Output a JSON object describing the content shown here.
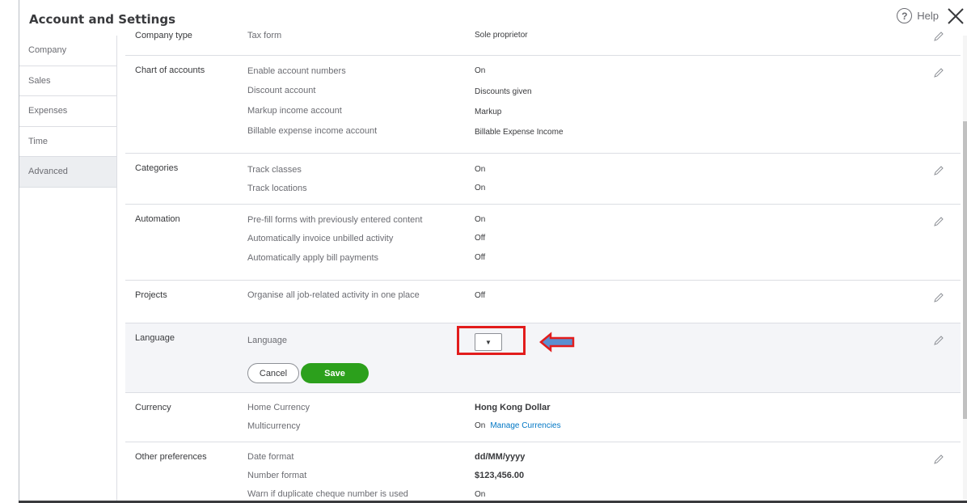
{
  "header": {
    "title": "Account and Settings",
    "help_label": "Help"
  },
  "sidebar": {
    "items": [
      "Company",
      "Sales",
      "Expenses",
      "Time",
      "Advanced"
    ]
  },
  "partial_row": {
    "title": "Company type",
    "label": "Tax form",
    "value": "Sole proprietor"
  },
  "chart_of_accounts": {
    "title": "Chart of accounts",
    "rows": [
      {
        "label": "Enable account numbers",
        "value": "On"
      },
      {
        "label": "Discount account",
        "value": "Discounts given"
      },
      {
        "label": "Markup income account",
        "value": "Markup"
      },
      {
        "label": "Billable expense income account",
        "value": "Billable Expense Income"
      }
    ]
  },
  "categories": {
    "title": "Categories",
    "rows": [
      {
        "label": "Track classes",
        "value": "On"
      },
      {
        "label": "Track locations",
        "value": "On"
      }
    ]
  },
  "automation": {
    "title": "Automation",
    "rows": [
      {
        "label": "Pre-fill forms with previously entered content",
        "value": "On"
      },
      {
        "label": "Automatically invoice unbilled activity",
        "value": "Off"
      },
      {
        "label": "Automatically apply bill payments",
        "value": "Off"
      }
    ]
  },
  "projects": {
    "title": "Projects",
    "rows": [
      {
        "label": "Organise all job-related activity in one place",
        "value": "Off"
      }
    ]
  },
  "language": {
    "title": "Language",
    "label": "Language",
    "dropdown_value": "",
    "cancel_label": "Cancel",
    "save_label": "Save"
  },
  "currency": {
    "title": "Currency",
    "rows": [
      {
        "label": "Home Currency",
        "value": "Hong Kong Dollar"
      },
      {
        "label": "Multicurrency",
        "value": "On",
        "link": "Manage Currencies"
      }
    ]
  },
  "other_preferences": {
    "title": "Other preferences",
    "rows": [
      {
        "label": "Date format",
        "value": "dd/MM/yyyy"
      },
      {
        "label": "Number format",
        "value": "$123,456.00"
      },
      {
        "label": "Warn if duplicate cheque number is used",
        "value": "On"
      }
    ]
  },
  "colors": {
    "save_green": "#2ca01c",
    "link_blue": "#0077c5",
    "highlight_red": "#e21c1c",
    "arrow_blue": "#5b8fd0"
  }
}
